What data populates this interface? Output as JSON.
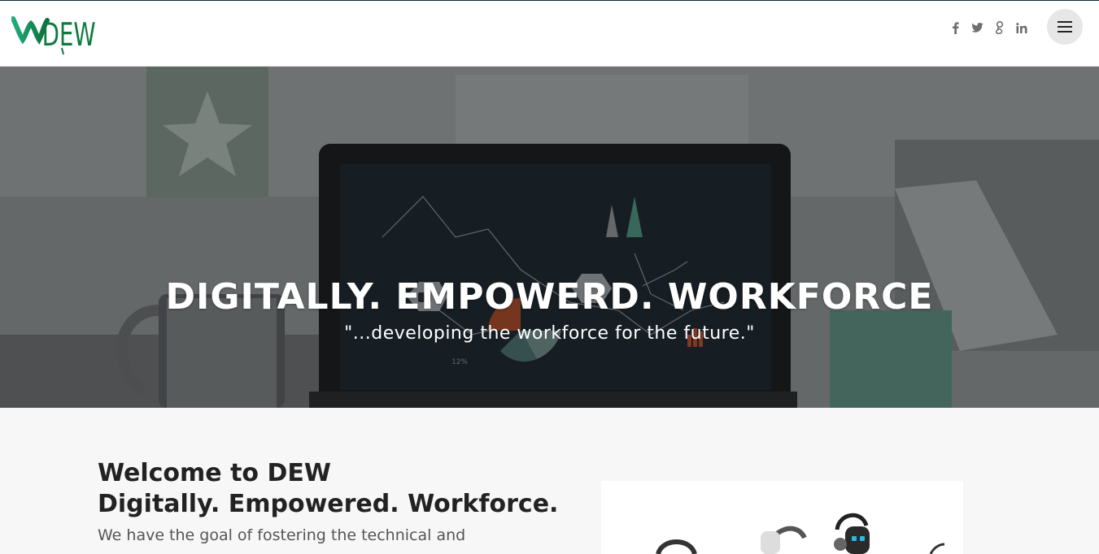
{
  "brand": {
    "logo_text": "DEW"
  },
  "social": {
    "facebook": "f",
    "twitter": "twitter-bird-icon",
    "googleplus": "g",
    "linkedin": "in"
  },
  "hero": {
    "title": "DIGITALLY. EMPOWERD. WORKFORCE",
    "subtitle": "\"...developing the workforce for the future.\""
  },
  "welcome": {
    "title_line1": "Welcome to DEW",
    "title_line2": "Digitally. Empowered. Workforce.",
    "text": "We have the goal of fostering the technical and"
  },
  "colors": {
    "brand_green": "#1a9b5a",
    "header_bg": "#ffffff",
    "content_bg": "#f7f7f7"
  }
}
